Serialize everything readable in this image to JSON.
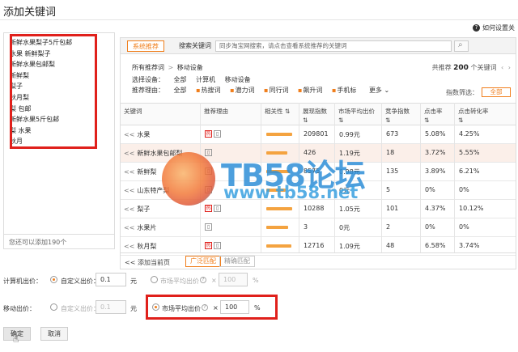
{
  "dialog": {
    "title": "添加关键词",
    "help": "如何设置关"
  },
  "left_panel": {
    "keywords": [
      "新鲜水果梨子5斤包邮",
      "水果 新鲜梨子",
      "新鲜水果包邮梨",
      "新鲜梨",
      "梨子",
      "秋月梨",
      "梨 包邮",
      "新鲜水果5斤包邮",
      "梨 水果",
      "秋月"
    ],
    "footer": "您还可以添加190个"
  },
  "tabs": {
    "active": "系统推荐",
    "second": "搜索关键词"
  },
  "search": {
    "placeholder": "同步淘宝网搜索，请点击查看系统推荐的关键词"
  },
  "breadcrumb": {
    "root": "所有推荐词",
    "separator": ">",
    "current": "移动设备"
  },
  "total": {
    "prefix": "共推荐",
    "count": "200",
    "suffix": "个关键词"
  },
  "device_filter": {
    "label": "选择设备：",
    "options": [
      "全部",
      "计算机",
      "移动设备"
    ]
  },
  "reason_filter": {
    "label": "推荐理由：",
    "options": [
      "全部",
      "热搜词",
      "潜力词",
      "同行词",
      "飙升词",
      "手机标"
    ],
    "more": "更多"
  },
  "sort": {
    "label": "指数筛选：",
    "value": "全部"
  },
  "table": {
    "headers": [
      "关键词",
      "推荐理由",
      "相关性",
      "展现指数",
      "市场平均出价",
      "竞争指数",
      "点击率",
      "点击转化率"
    ],
    "rows": [
      {
        "keyword": "水果",
        "shown": "209801",
        "bid": "0.99元",
        "comp": "673",
        "ctr": "5.08%",
        "cvr": "4.25%",
        "rel": 0.95,
        "hot": true
      },
      {
        "keyword": "新鲜水果包邮梨",
        "shown": "426",
        "bid": "1.19元",
        "comp": "18",
        "ctr": "3.72%",
        "cvr": "5.55%",
        "rel": 0.75,
        "hot": false
      },
      {
        "keyword": "新鲜梨",
        "shown": "8575",
        "bid": "0.98元",
        "comp": "135",
        "ctr": "3.89%",
        "cvr": "6.21%",
        "rel": 0.85,
        "hot": false
      },
      {
        "keyword": "山东特产梨",
        "shown": "",
        "bid": "0元",
        "comp": "5",
        "ctr": "0%",
        "cvr": "0%",
        "rel": 0.7,
        "hot": false
      },
      {
        "keyword": "梨子",
        "shown": "10288",
        "bid": "1.05元",
        "comp": "101",
        "ctr": "4.37%",
        "cvr": "10.12%",
        "rel": 0.95,
        "hot": true
      },
      {
        "keyword": "水果片",
        "shown": "3",
        "bid": "0元",
        "comp": "2",
        "ctr": "0%",
        "cvr": "0%",
        "rel": 0.8,
        "hot": false
      },
      {
        "keyword": "秋月梨",
        "shown": "12716",
        "bid": "1.09元",
        "comp": "48",
        "ctr": "6.58%",
        "cvr": "3.74%",
        "rel": 0.9,
        "hot": true
      }
    ],
    "row_prefix": "<<"
  },
  "table_footer": {
    "add_page": "<< 添加当前页",
    "match_broad": "广泛匹配",
    "match_exact": "精确匹配"
  },
  "computer_bid": {
    "label": "计算机出价：",
    "custom": "自定义出价：",
    "custom_value": "0.1",
    "unit": "元",
    "market": "市场平均出价",
    "times": "×",
    "percent_value": "100",
    "percent_unit": "%"
  },
  "mobile_bid": {
    "label": "移动出价：",
    "custom": "自定义出价：",
    "custom_value": "0.1",
    "unit": "元",
    "market": "市场平均出价",
    "times": "×",
    "percent_value": "100",
    "percent_unit": "%"
  },
  "buttons": {
    "ok": "确定",
    "cancel": "取消"
  },
  "watermark": {
    "title": "TB58论坛",
    "url": "www.tb58.net"
  },
  "colors": {
    "accent": "#f07e1b",
    "highlight": "#e0201b",
    "row_hover": "#fbefe9"
  }
}
